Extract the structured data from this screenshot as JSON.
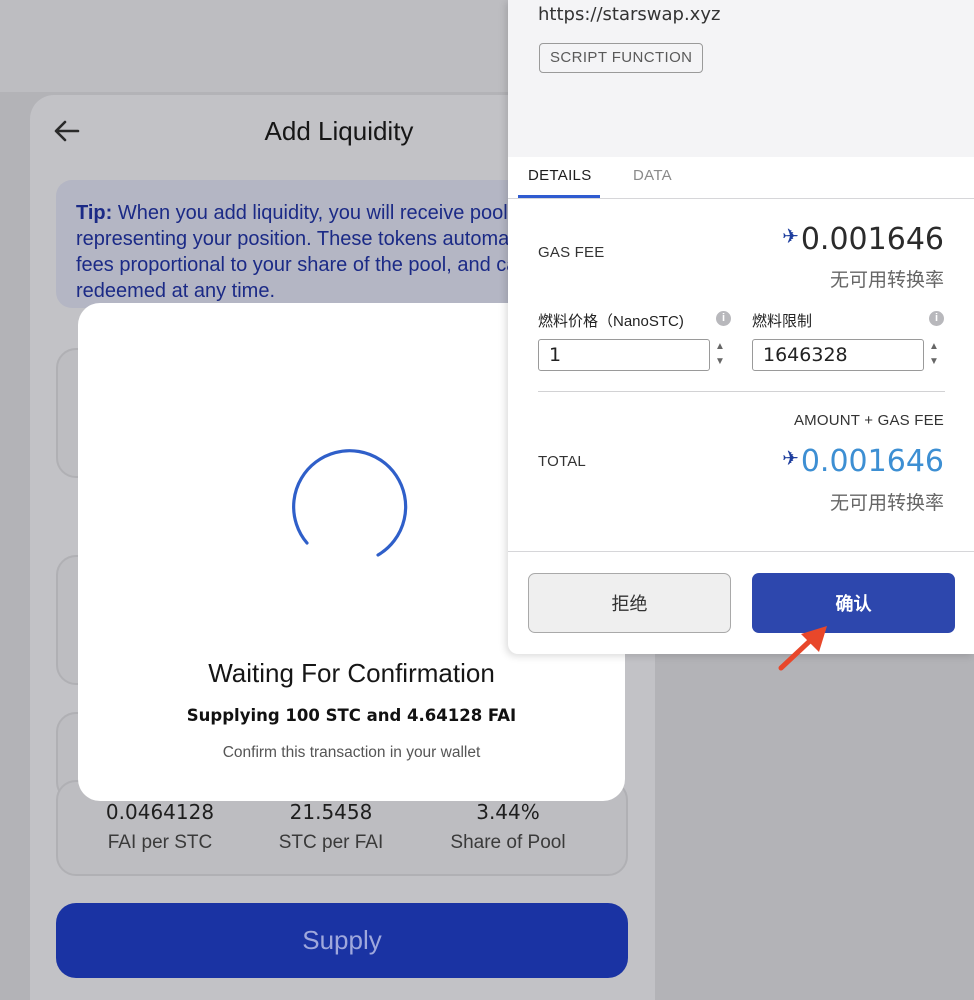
{
  "dapp": {
    "title": "Add Liquidity",
    "tip": {
      "label": "Tip:",
      "text": " When you add liquidity, you will receive pool tokens representing your position. These tokens automatically earn fees proportional to your share of the pool, and can be redeemed at any time."
    },
    "stats": [
      {
        "value": "0.0464128",
        "label": "FAI per STC"
      },
      {
        "value": "21.5458",
        "label": "STC per FAI"
      },
      {
        "value": "3.44%",
        "label": "Share of Pool"
      }
    ],
    "supply_label": "Supply",
    "accent_color": "#1a33a3"
  },
  "modal": {
    "title": "Waiting For Confirmation",
    "subtitle": "Supplying 100 STC and 4.64128 FAI",
    "hint": "Confirm this transaction in your wallet"
  },
  "wallet": {
    "origin": "https://starswap.xyz",
    "type_badge": "SCRIPT FUNCTION",
    "tabs": [
      {
        "label": "DETAILS",
        "active": true
      },
      {
        "label": "DATA",
        "active": false
      }
    ],
    "gas_fee": {
      "label": "GAS FEE",
      "value": "0.001646",
      "conversion": "无可用转换率"
    },
    "gas_price": {
      "label": "燃料价格（NanoSTC)",
      "value": "1"
    },
    "gas_limit": {
      "label": "燃料限制",
      "value": "1646328"
    },
    "amount_gas_label": "AMOUNT + GAS FEE",
    "total": {
      "label": "TOTAL",
      "value": "0.001646",
      "conversion": "无可用转换率"
    },
    "reject_label": "拒绝",
    "confirm_label": "确认",
    "confirm_color": "#2d47ad",
    "total_color": "#3d8fd3"
  }
}
